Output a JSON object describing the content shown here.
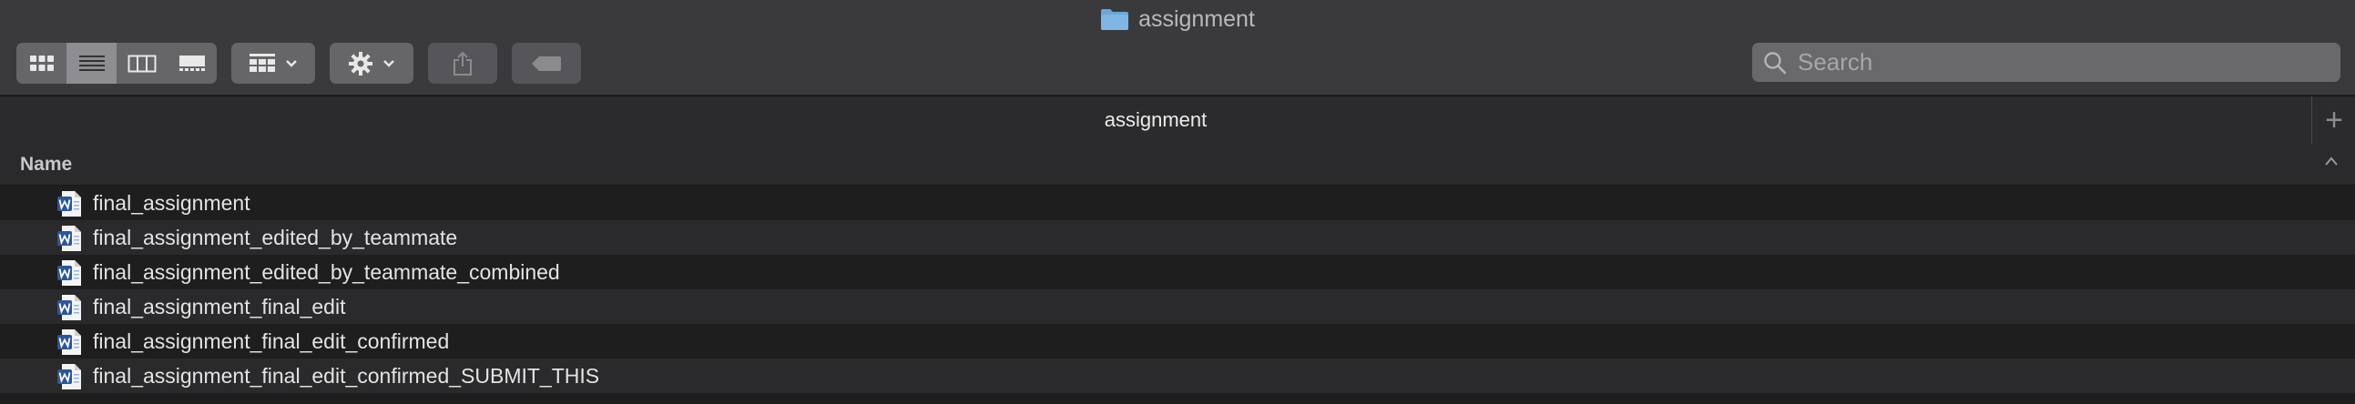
{
  "window": {
    "title": "assignment"
  },
  "toolbar": {
    "view_buttons": [
      {
        "icon": "icon-view-icon",
        "active": false
      },
      {
        "icon": "list-view-icon",
        "active": true
      },
      {
        "icon": "column-view-icon",
        "active": false
      },
      {
        "icon": "gallery-view-icon",
        "active": false
      }
    ],
    "group_icon": "group-by-icon",
    "action_icon": "gear-icon",
    "share_icon": "share-icon",
    "tag_icon": "tag-icon"
  },
  "search": {
    "placeholder": "Search",
    "value": ""
  },
  "pathbar": {
    "label": "assignment",
    "add_tab": "+"
  },
  "list": {
    "column_name": "Name",
    "files": [
      {
        "name": "final_assignment"
      },
      {
        "name": "final_assignment_edited_by_teammate"
      },
      {
        "name": "final_assignment_edited_by_teammate_combined"
      },
      {
        "name": "final_assignment_final_edit"
      },
      {
        "name": "final_assignment_final_edit_confirmed"
      },
      {
        "name": "final_assignment_final_edit_confirmed_SUBMIT_THIS"
      }
    ]
  },
  "colors": {
    "folder": "#6aa7d8",
    "word_blue": "#2b579a",
    "accent": "#8e8e92"
  }
}
